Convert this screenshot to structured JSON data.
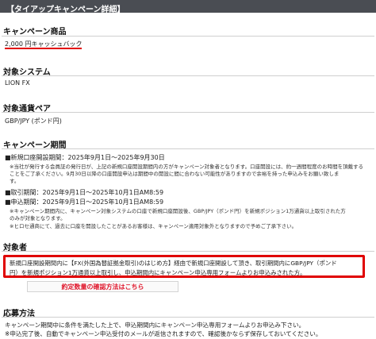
{
  "header": {
    "title": "【タイアップキャンペーン詳細】"
  },
  "campaign_product": {
    "heading": "キャンペーン商品",
    "value": "2,000 円キャッシュバック"
  },
  "target_system": {
    "heading": "対象システム",
    "value": "LION FX"
  },
  "target_pair": {
    "heading": "対象通貨ペア",
    "value": "GBP/JPY (ポンド円)"
  },
  "period": {
    "heading": "キャンペーン期間",
    "open_period": "■新規口座開設期間：2025年9月1日～2025年9月30日",
    "open_note_1": "※当社が発行する会員証の発行日が、上記の新規口座開設期間内の方がキャンペーン対象者となります。口座開設には、約一週間程度のお時間を頂戴する",
    "open_note_2": "ことをご了承ください。9月30日以降の口座開設申込は期間中の開設に間に合わない可能性がありますので余裕を持った申込みをお願い致しま",
    "open_note_3": "す。",
    "trade_period": "■取引期間：2025年9月1日～2025年10月1日AM8:59",
    "apply_period": "■申込期間：2025年9月1日～2025年10月1日AM8:59",
    "apply_note_1": "※キャンペーン期間内に、キャンペーン対象システムの口座で新規口座開設後、GBP/JPY（ポンド円）を新規ポジション1万通貨以上取引された方",
    "apply_note_2": "のみが対象となります。",
    "apply_note_3": "※ヒロセ通商にて、過去に口座を開設したことがあるお客様は、キャンペーン適用対象外となりますので予めご了承下さい。"
  },
  "target_person": {
    "heading": "対象者",
    "line1": "新規口座開設期間内に【FX(外国為替証拠金取引)のはじめ方】経由で新規口座開設して頂き、取引期間内にGBP/JPY（ポンド",
    "line2": "円）を新規ポジション1万通貨以上取引し、申込期間内にキャンペーン申込専用フォームよりお申込みされた方。",
    "button": "約定数量の確認方法はこちら"
  },
  "apply_method": {
    "heading": "応募方法",
    "line1": "キャンペーン期間中に条件を満たした上で、申込期間内にキャンペーン申込専用フォームよりお申込み下さい。",
    "line2": "※申込完了後、自動でキャンペーン申込受付のメールが返信されますので、確認後かならず保存しておいてください。"
  },
  "colors": {
    "topbar": "#4a4d53",
    "accent_red": "#e00000",
    "link_red": "#e0182d"
  }
}
